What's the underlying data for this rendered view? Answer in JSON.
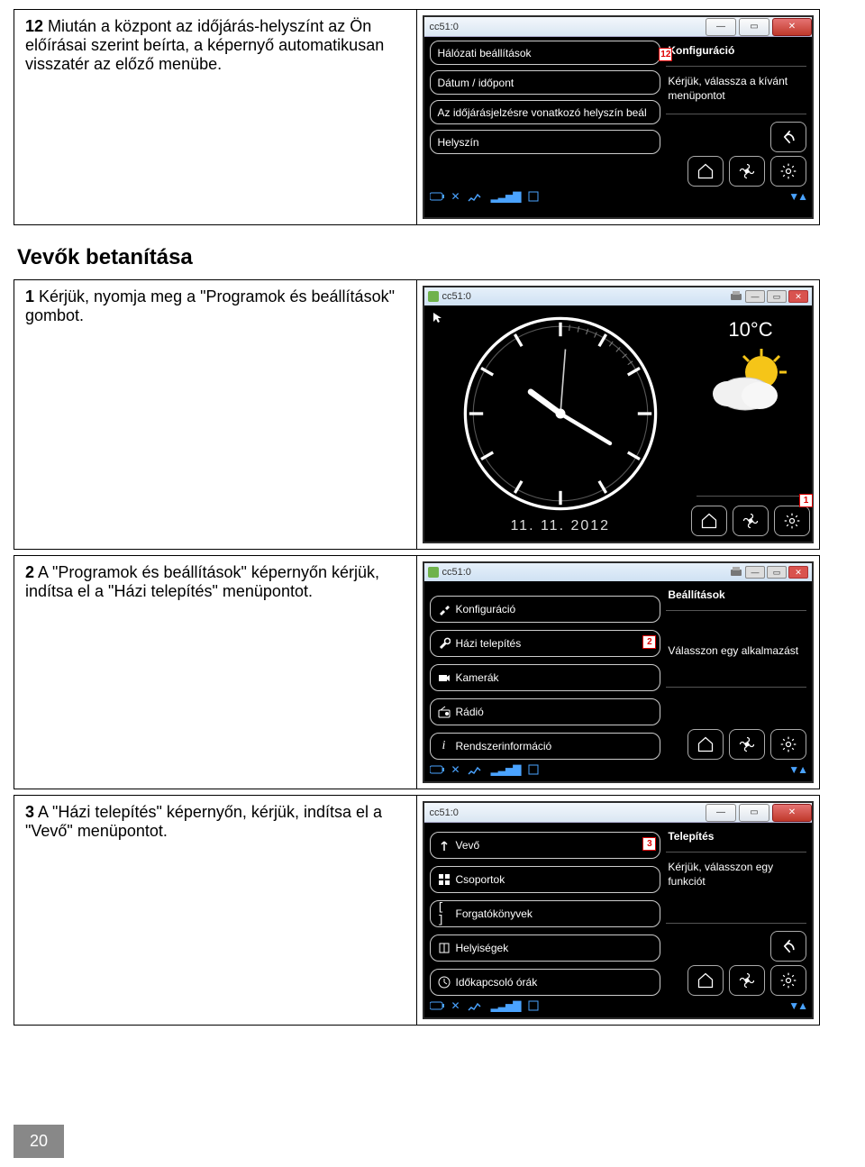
{
  "page_number": "20",
  "section_title": "Vevők betanítása",
  "steps": {
    "s12": {
      "num": "12",
      "text": " Miután a központ az időjárás-helyszínt az Ön előírásai szerint beírta, a képernyő automatikusan visszatér az előző menübe."
    },
    "s1": {
      "num": "1",
      "text": " Kérjük, nyomja meg a \"Programok és beállítások\" gombot."
    },
    "s2": {
      "num": "2",
      "text": " A \"Programok és beállítások\" képernyőn kérjük, indítsa el a \"Házi telepítés\" menüpontot."
    },
    "s3": {
      "num": "3",
      "text": " A \"Házi telepítés\" képernyőn, kérjük, indítsa el a \"Vevő\" menüpontot."
    }
  },
  "common": {
    "title": "cc51:0"
  },
  "shot_a": {
    "menu": [
      "Hálózati beállítások",
      "Dátum / időpont",
      "Az időjárásjelzésre vonatkozó helyszín beál",
      "Helyszín"
    ],
    "side_head": "Konfiguráció",
    "side_text": "Kérjük, válassza a kívánt menüpontot",
    "badge": "12"
  },
  "shot_b": {
    "temp": "10°C",
    "date": "11. 11. 2012",
    "badge": "1"
  },
  "shot_c": {
    "menu": [
      "Konfiguráció",
      "Házi telepítés",
      "Kamerák",
      "Rádió",
      "Rendszerinformáció"
    ],
    "side_head": "Beállítások",
    "side_text": "Válasszon egy alkalmazást",
    "badge": "2"
  },
  "shot_d": {
    "menu": [
      "Vevő",
      "Csoportok",
      "Forgatókönyvek",
      "Helyiségek",
      "Időkapcsoló órák"
    ],
    "side_head": "Telepítés",
    "side_text": "Kérjük, válasszon egy funkciót",
    "badge": "3"
  }
}
